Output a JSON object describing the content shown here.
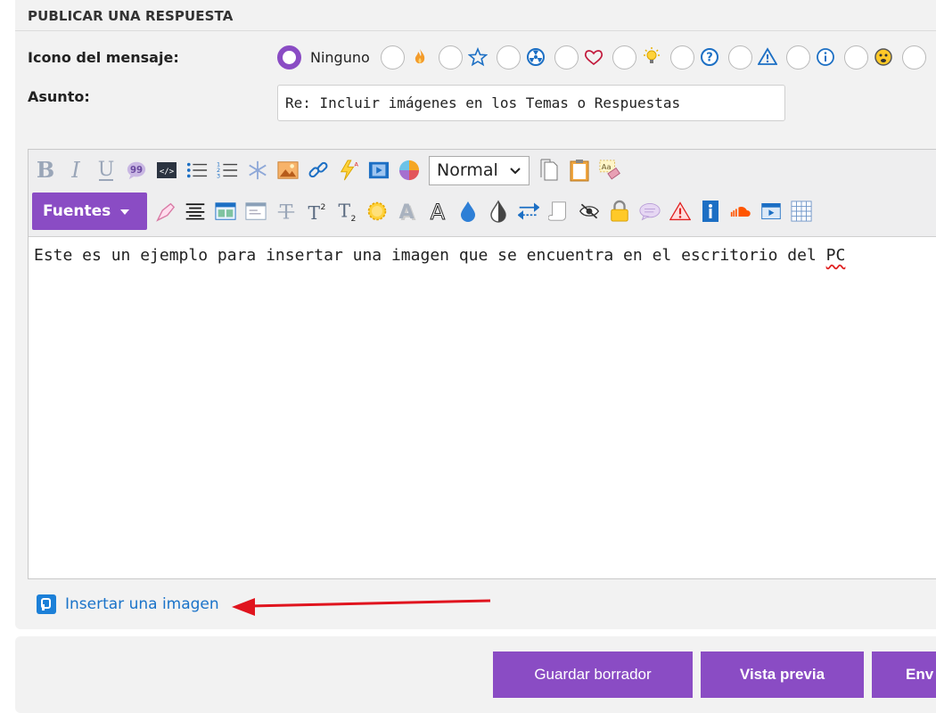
{
  "form": {
    "title": "PUBLICAR UNA RESPUESTA",
    "message_icon_label": "Icono del mensaje:",
    "subject_label": "Asunto:",
    "subject_value": "Re: Incluir imágenes en los Temas o Respuestas",
    "icon_options": [
      {
        "name": "none",
        "label": "Ninguno",
        "selected": true
      },
      {
        "name": "fire-icon"
      },
      {
        "name": "star-icon"
      },
      {
        "name": "radiation-icon"
      },
      {
        "name": "heart-icon"
      },
      {
        "name": "lightbulb-icon"
      },
      {
        "name": "question-icon"
      },
      {
        "name": "warning-icon"
      },
      {
        "name": "info-icon"
      },
      {
        "name": "emoji-icon"
      }
    ]
  },
  "toolbar": {
    "font_size_select": "Normal",
    "fonts_button": "Fuentes"
  },
  "editor": {
    "content": "Este es un ejemplo para insertar una imagen que se encuentra en el escritorio del ",
    "content_misspelled": "PC"
  },
  "insert_image": {
    "label": "Insertar una imagen"
  },
  "buttons": {
    "save_draft": "Guardar borrador",
    "preview": "Vista previa",
    "send": "Env"
  },
  "colors": {
    "accent": "#8a4cc4",
    "link": "#1a73c9",
    "annotation_arrow": "#e0141e"
  }
}
